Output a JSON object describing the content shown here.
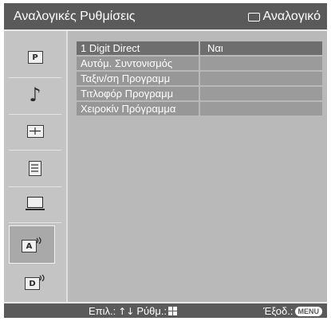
{
  "header": {
    "title": "Αναλογικές Ρυθμίσεις",
    "source": "Αναλογικό",
    "source_icon": "tv-icon"
  },
  "sidebar": {
    "items": [
      {
        "name": "picture-icon",
        "glyph": "P"
      },
      {
        "name": "music-note-icon",
        "glyph": "♪"
      },
      {
        "name": "screen-icon",
        "glyph": "⊞"
      },
      {
        "name": "settings-list-icon",
        "glyph": "☰"
      },
      {
        "name": "pc-icon",
        "glyph": ""
      },
      {
        "name": "analog-setup-icon",
        "glyph": "A",
        "selected": true
      },
      {
        "name": "digital-setup-icon",
        "glyph": "D"
      }
    ]
  },
  "menu": {
    "rows": [
      {
        "label": "1 Digit Direct",
        "value": "Ναι",
        "selected": true
      },
      {
        "label": "Αυτόμ. Συντονισμός",
        "value": ""
      },
      {
        "label": "Ταξιν/ση Προγραμμ",
        "value": ""
      },
      {
        "label": "Τιτλοφόρ Προγραμμ",
        "value": ""
      },
      {
        "label": "Χειροκίν Πρόγραμμα",
        "value": ""
      }
    ]
  },
  "footer": {
    "select_label": "Επιλ.:",
    "select_arrows": "↑↓",
    "adjust_label": "Ρύθμ.:",
    "exit_label": "Έξοδ.:",
    "exit_key": "MENU"
  }
}
